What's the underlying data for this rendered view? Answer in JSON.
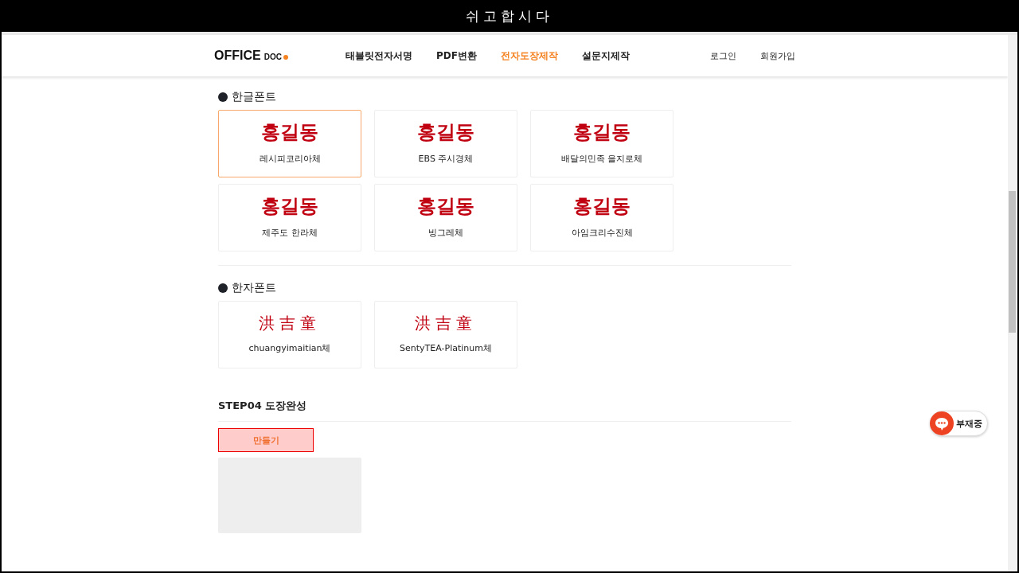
{
  "window": {
    "title": "쉬고합시다"
  },
  "header": {
    "logo": {
      "main": "OFFICE",
      "sub": "DOC"
    },
    "nav": [
      {
        "label": "태블릿전자서명",
        "selected": false
      },
      {
        "label": "PDF변환",
        "selected": false
      },
      {
        "label": "전자도장제작",
        "selected": true
      },
      {
        "label": "설문지제작",
        "selected": false
      }
    ],
    "account": [
      "로그인",
      "회원가입"
    ]
  },
  "font_sections": [
    {
      "title": "한글폰트",
      "fonts": [
        {
          "sample": "홍길동",
          "name": "레시피코리아체",
          "selected": true
        },
        {
          "sample": "홍길동",
          "name": "EBS 주시경체",
          "selected": false
        },
        {
          "sample": "홍길동",
          "name": "배달의민족 을지로체",
          "selected": false
        },
        {
          "sample": "홍길동",
          "name": "제주도 한라체",
          "selected": false
        },
        {
          "sample": "홍길동",
          "name": "빙그레체",
          "selected": false
        },
        {
          "sample": "홍길동",
          "name": "아임크리수진체",
          "selected": false
        }
      ]
    },
    {
      "title": "한자폰트",
      "fonts": [
        {
          "sample": "洪吉童",
          "name": "chuangyimaitian체",
          "selected": false
        },
        {
          "sample": "洪吉童",
          "name": "SentyTEA-Platinum체",
          "selected": false
        }
      ]
    }
  ],
  "step": {
    "title": "STEP04 도장완성",
    "button": "만들기"
  },
  "chat": {
    "status": "부재중"
  }
}
